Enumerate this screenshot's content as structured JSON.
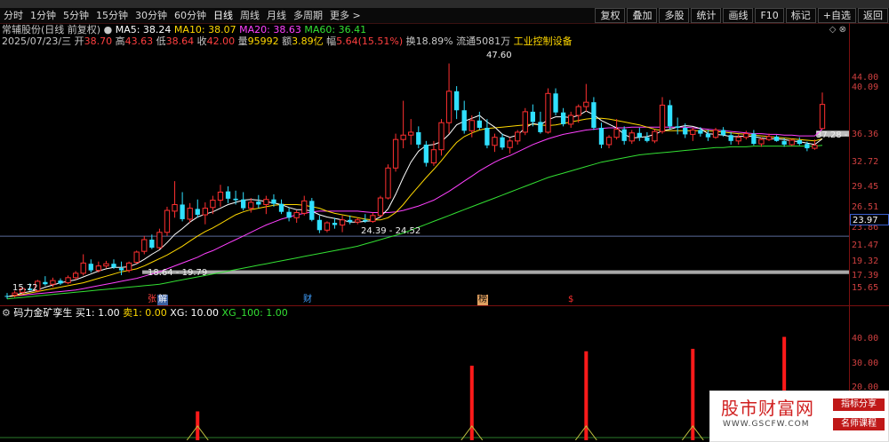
{
  "toolbar": {
    "left": [
      "分时",
      "1分钟",
      "5分钟",
      "15分钟",
      "30分钟",
      "60分钟",
      "日线",
      "周线",
      "月线",
      "多周期",
      "更多 >"
    ],
    "right": [
      "复权",
      "叠加",
      "多股",
      "统计",
      "画线",
      "F10",
      "标记",
      "+自选",
      "返回"
    ]
  },
  "header": {
    "name": "常辅股份(日线 前复权)",
    "ma5": "MA5: 38.24",
    "ma10": "MA10: 38.07",
    "ma20": "MA20: 38.63",
    "ma60": "MA60: 36.41",
    "date": "2025/07/23/三",
    "open_label": "开",
    "open": "38.70",
    "high_label": "高",
    "high": "43.63",
    "low_label": "低",
    "low": "38.64",
    "close_label": "收",
    "close": "42.00",
    "vol_label": "量",
    "vol": "95992",
    "amt_label": "额",
    "amt": "3.89亿",
    "chg_label": "幅",
    "chg": "5.64(15.51%)",
    "turn": "换18.89%",
    "float": "流通5081万",
    "industry": "工业控制设备",
    "icons": "◇ ⊗"
  },
  "yaxis": [
    "44.00",
    "40.09",
    "36.36",
    "32.72",
    "29.45",
    "26.51",
    "23.97",
    "23.86",
    "21.47",
    "19.32",
    "17.39",
    "15.65"
  ],
  "current_price": "23.97",
  "annotations": {
    "peak": "47.60",
    "right": "37.28 -",
    "mid": "24.39 - 24.52",
    "left_low": "18.64 - 19.79",
    "start": "15.72"
  },
  "markers": {
    "m1": "张",
    "m2": "解",
    "m3": "财",
    "m4": "榜",
    "m5": "$"
  },
  "indicator": {
    "name": "码力金矿孪生",
    "buy": "买1: 1.00",
    "sell": "卖1: 0.00",
    "xg": "XG: 10.00",
    "xg100": "XG_100: 1.00",
    "yaxis": [
      "40.00",
      "30.00",
      "20.00"
    ]
  },
  "watermark": {
    "title": "股市财富网",
    "url": "WWW.GSCFW.COM",
    "tag1": "指标分享",
    "tag2": "名师课程"
  },
  "colors": {
    "up": "#ff3030",
    "down": "#30e0ff",
    "ma5": "#ffffff",
    "ma10": "#ffd800",
    "ma20": "#ff40ff",
    "ma60": "#33e033"
  },
  "chart_data": {
    "type": "candlestick",
    "ylim": [
      15.0,
      49.0
    ],
    "candles": [
      [
        15.8,
        16.2,
        15.4,
        15.72
      ],
      [
        15.9,
        16.5,
        15.6,
        16.2
      ],
      [
        16.3,
        17.0,
        16.0,
        16.8
      ],
      [
        16.8,
        17.5,
        16.5,
        16.6
      ],
      [
        16.5,
        18.0,
        16.3,
        17.8
      ],
      [
        17.7,
        18.5,
        17.2,
        17.4
      ],
      [
        17.4,
        18.3,
        17.0,
        17.9
      ],
      [
        17.9,
        18.2,
        17.3,
        17.5
      ],
      [
        17.6,
        18.6,
        17.4,
        18.3
      ],
      [
        18.3,
        19.2,
        18.0,
        18.9
      ],
      [
        18.9,
        21.5,
        18.6,
        20.3
      ],
      [
        20.2,
        20.8,
        19.0,
        19.3
      ],
      [
        19.3,
        20.5,
        19.0,
        19.9
      ],
      [
        19.9,
        20.6,
        19.6,
        20.2
      ],
      [
        20.2,
        20.8,
        19.5,
        19.7
      ],
      [
        19.6,
        20.5,
        18.64,
        19.3
      ],
      [
        19.3,
        20.5,
        19.0,
        20.3
      ],
      [
        20.4,
        22.0,
        20.2,
        21.8
      ],
      [
        21.9,
        24.0,
        21.5,
        23.5
      ],
      [
        23.5,
        24.2,
        22.2,
        22.4
      ],
      [
        22.4,
        25.0,
        22.2,
        24.5
      ],
      [
        24.5,
        28.0,
        24.0,
        27.5
      ],
      [
        27.4,
        31.5,
        26.5,
        28.3
      ],
      [
        28.3,
        30.0,
        26.0,
        26.3
      ],
      [
        26.3,
        28.5,
        25.8,
        27.8
      ],
      [
        27.7,
        29.0,
        26.5,
        26.9
      ],
      [
        26.9,
        28.6,
        25.6,
        27.8
      ],
      [
        27.9,
        29.5,
        27.0,
        28.9
      ],
      [
        28.9,
        31.0,
        28.0,
        30.0
      ],
      [
        30.1,
        30.8,
        28.5,
        29.1
      ],
      [
        29.1,
        30.2,
        28.3,
        28.9
      ],
      [
        29.0,
        30.0,
        27.5,
        27.8
      ],
      [
        27.8,
        29.2,
        27.2,
        28.6
      ],
      [
        28.7,
        29.6,
        27.8,
        28.3
      ],
      [
        28.3,
        29.5,
        27.0,
        29.0
      ],
      [
        29.0,
        29.7,
        28.0,
        28.4
      ],
      [
        28.4,
        29.0,
        27.0,
        27.3
      ],
      [
        27.3,
        27.9,
        26.0,
        26.5
      ],
      [
        26.5,
        27.5,
        25.8,
        27.2
      ],
      [
        27.1,
        29.5,
        26.8,
        28.8
      ],
      [
        28.8,
        29.2,
        26.0,
        26.2
      ],
      [
        26.2,
        26.8,
        24.39,
        24.8
      ],
      [
        24.8,
        26.0,
        24.5,
        25.8
      ],
      [
        25.8,
        26.5,
        25.0,
        25.5
      ],
      [
        25.5,
        26.8,
        24.52,
        26.2
      ],
      [
        26.2,
        26.8,
        25.6,
        25.9
      ],
      [
        25.9,
        26.5,
        25.6,
        26.2
      ],
      [
        26.2,
        27.0,
        25.8,
        26.0
      ],
      [
        26.0,
        27.2,
        25.8,
        26.8
      ],
      [
        26.8,
        29.5,
        26.6,
        29.2
      ],
      [
        29.2,
        33.8,
        29.0,
        33.3
      ],
      [
        33.3,
        38.0,
        32.8,
        37.2
      ],
      [
        37.2,
        42.5,
        36.0,
        37.8
      ],
      [
        37.8,
        40.0,
        36.5,
        38.2
      ],
      [
        38.2,
        39.0,
        36.0,
        36.5
      ],
      [
        36.5,
        37.0,
        33.5,
        34.0
      ],
      [
        34.0,
        37.0,
        33.6,
        35.8
      ],
      [
        35.8,
        40.0,
        35.0,
        39.5
      ],
      [
        39.5,
        47.6,
        38.0,
        43.8
      ],
      [
        43.8,
        44.5,
        40.0,
        41.2
      ],
      [
        41.2,
        42.5,
        38.0,
        38.4
      ],
      [
        38.4,
        40.5,
        37.5,
        39.8
      ],
      [
        39.8,
        41.0,
        38.5,
        38.8
      ],
      [
        38.8,
        40.0,
        36.0,
        36.4
      ],
      [
        36.4,
        38.0,
        35.5,
        37.5
      ],
      [
        37.5,
        38.0,
        35.8,
        36.1
      ],
      [
        36.1,
        37.5,
        35.3,
        37.0
      ],
      [
        37.0,
        38.5,
        36.5,
        38.2
      ],
      [
        38.2,
        41.5,
        37.8,
        41.0
      ],
      [
        41.0,
        42.0,
        39.0,
        39.6
      ],
      [
        39.6,
        41.0,
        38.0,
        38.2
      ],
      [
        38.2,
        44.2,
        38.0,
        43.5
      ],
      [
        43.5,
        44.2,
        40.5,
        40.9
      ],
      [
        40.9,
        41.5,
        39.0,
        39.3
      ],
      [
        39.3,
        41.0,
        38.8,
        40.5
      ],
      [
        40.5,
        42.0,
        39.5,
        41.7
      ],
      [
        41.7,
        44.8,
        41.0,
        42.3
      ],
      [
        42.3,
        43.0,
        38.5,
        38.8
      ],
      [
        38.8,
        39.5,
        36.0,
        36.5
      ],
      [
        36.5,
        37.8,
        36.0,
        37.5
      ],
      [
        37.5,
        40.0,
        37.2,
        38.6
      ],
      [
        38.6,
        39.0,
        36.5,
        37.0
      ],
      [
        37.0,
        38.5,
        36.6,
        38.1
      ],
      [
        38.1,
        38.8,
        37.0,
        37.5
      ],
      [
        37.5,
        38.2,
        36.8,
        37.0
      ],
      [
        37.0,
        38.6,
        36.7,
        38.3
      ],
      [
        38.3,
        43.0,
        38.0,
        41.9
      ],
      [
        41.9,
        42.6,
        38.6,
        39.0
      ],
      [
        39.0,
        40.2,
        37.9,
        38.8
      ],
      [
        38.8,
        39.4,
        37.4,
        37.9
      ],
      [
        37.9,
        38.8,
        37.0,
        38.5
      ],
      [
        38.5,
        38.9,
        37.6,
        38.0
      ],
      [
        38.0,
        38.5,
        37.0,
        37.5
      ],
      [
        37.5,
        38.8,
        37.3,
        38.5
      ],
      [
        38.5,
        38.9,
        37.6,
        37.8
      ],
      [
        37.8,
        38.2,
        36.5,
        37.0
      ],
      [
        37.0,
        37.9,
        36.5,
        37.5
      ],
      [
        37.5,
        38.4,
        37.2,
        38.0
      ],
      [
        38.0,
        38.5,
        36.4,
        36.6
      ],
      [
        36.6,
        37.5,
        36.2,
        37.2
      ],
      [
        37.2,
        38.0,
        37.0,
        37.6
      ],
      [
        37.6,
        37.8,
        36.9,
        37.0
      ],
      [
        37.0,
        37.4,
        36.2,
        36.5
      ],
      [
        36.5,
        37.3,
        36.3,
        37.1
      ],
      [
        37.1,
        37.5,
        36.4,
        36.6
      ],
      [
        36.6,
        36.9,
        35.6,
        36.0
      ],
      [
        36.0,
        37.2,
        35.8,
        36.4
      ],
      [
        38.7,
        43.63,
        38.64,
        42.0
      ]
    ],
    "ma5": [
      15.7,
      15.9,
      16.2,
      16.4,
      16.6,
      17.0,
      17.3,
      17.6,
      17.8,
      18.0,
      18.4,
      18.8,
      19.2,
      19.5,
      19.7,
      19.7,
      19.8,
      20.2,
      20.8,
      21.5,
      22.1,
      23.1,
      24.2,
      25.0,
      25.9,
      26.6,
      27.0,
      27.3,
      27.8,
      28.3,
      28.6,
      28.9,
      29.0,
      28.9,
      28.7,
      28.5,
      28.3,
      27.9,
      27.6,
      27.6,
      27.4,
      26.9,
      26.6,
      26.4,
      26.2,
      25.9,
      25.9,
      26.0,
      26.1,
      26.6,
      27.7,
      29.7,
      32.0,
      34.1,
      35.6,
      36.4,
      36.5,
      36.9,
      37.9,
      39.2,
      39.7,
      40.1,
      40.5,
      39.6,
      38.9,
      37.9,
      37.5,
      37.8,
      38.8,
      39.4,
      39.2,
      39.9,
      40.3,
      40.3,
      40.2,
      40.5,
      41.1,
      40.6,
      39.8,
      39.3,
      38.8,
      37.9,
      37.4,
      37.5,
      37.6,
      37.9,
      38.4,
      38.6,
      38.9,
      39.1,
      39.0,
      38.7,
      38.0,
      37.9,
      37.8,
      37.6,
      37.6,
      37.7,
      37.6,
      37.4,
      37.3,
      37.3,
      37.2,
      37.0,
      36.9,
      36.7,
      36.5,
      37.3
    ],
    "ma10": [
      15.7,
      15.8,
      16.0,
      16.2,
      16.4,
      16.6,
      16.8,
      17.0,
      17.2,
      17.4,
      17.6,
      17.9,
      18.2,
      18.5,
      18.8,
      19.1,
      19.3,
      19.5,
      19.9,
      20.4,
      20.9,
      21.4,
      22.0,
      22.6,
      23.3,
      24.0,
      24.6,
      25.1,
      25.7,
      26.3,
      26.9,
      27.3,
      27.6,
      27.8,
      28.0,
      28.2,
      28.3,
      28.3,
      28.3,
      28.2,
      28.0,
      27.8,
      27.4,
      27.1,
      26.9,
      26.7,
      26.5,
      26.3,
      26.2,
      26.2,
      26.5,
      27.2,
      28.3,
      29.6,
      30.8,
      32.0,
      33.1,
      34.3,
      35.6,
      36.8,
      37.6,
      38.1,
      38.5,
      38.7,
      38.8,
      38.9,
      39.0,
      39.1,
      39.2,
      39.3,
      39.2,
      39.1,
      39.2,
      39.4,
      39.6,
      39.8,
      40.0,
      40.1,
      40.1,
      40.0,
      39.8,
      39.6,
      39.4,
      39.2,
      38.9,
      38.6,
      38.4,
      38.4,
      38.4,
      38.4,
      38.4,
      38.4,
      38.4,
      38.3,
      38.2,
      38.1,
      38.0,
      37.9,
      37.8,
      37.7,
      37.6,
      37.5,
      37.4,
      37.3,
      37.2,
      37.1,
      37.0,
      37.3
    ],
    "ma20": [
      15.7,
      15.8,
      15.9,
      16.0,
      16.1,
      16.2,
      16.3,
      16.4,
      16.5,
      16.6,
      16.8,
      17.0,
      17.2,
      17.4,
      17.6,
      17.8,
      18.0,
      18.2,
      18.5,
      18.8,
      19.1,
      19.5,
      19.9,
      20.3,
      20.7,
      21.1,
      21.6,
      22.0,
      22.5,
      23.0,
      23.5,
      24.0,
      24.5,
      25.0,
      25.5,
      25.9,
      26.3,
      26.6,
      26.9,
      27.1,
      27.3,
      27.4,
      27.4,
      27.4,
      27.4,
      27.4,
      27.4,
      27.3,
      27.2,
      27.2,
      27.2,
      27.3,
      27.5,
      27.8,
      28.1,
      28.5,
      28.9,
      29.5,
      30.1,
      30.8,
      31.5,
      32.2,
      32.9,
      33.5,
      34.1,
      34.6,
      35.0,
      35.5,
      36.0,
      36.5,
      36.9,
      37.3,
      37.6,
      37.9,
      38.1,
      38.3,
      38.5,
      38.6,
      38.7,
      38.8,
      38.8,
      38.8,
      38.9,
      38.9,
      38.9,
      38.9,
      38.9,
      38.9,
      38.9,
      38.9,
      38.8,
      38.7,
      38.6,
      38.5,
      38.4,
      38.3,
      38.2,
      38.1,
      38.0,
      38.0,
      37.9,
      37.9,
      37.8,
      37.8,
      37.7,
      37.7,
      37.7,
      38.63
    ],
    "ma60": [
      15.4,
      15.5,
      15.6,
      15.7,
      15.8,
      15.9,
      16.0,
      16.1,
      16.2,
      16.3,
      16.4,
      16.5,
      16.6,
      16.7,
      16.8,
      16.9,
      17.0,
      17.1,
      17.2,
      17.3,
      17.4,
      17.6,
      17.8,
      18.0,
      18.2,
      18.4,
      18.6,
      18.8,
      19.0,
      19.2,
      19.4,
      19.6,
      19.8,
      20.0,
      20.2,
      20.4,
      20.6,
      20.8,
      21.0,
      21.2,
      21.4,
      21.6,
      21.8,
      22.0,
      22.2,
      22.4,
      22.6,
      22.9,
      23.2,
      23.5,
      23.8,
      24.1,
      24.4,
      24.8,
      25.2,
      25.6,
      26.0,
      26.4,
      26.8,
      27.2,
      27.6,
      28.0,
      28.4,
      28.8,
      29.2,
      29.6,
      30.0,
      30.4,
      30.8,
      31.2,
      31.6,
      32.0,
      32.3,
      32.6,
      32.9,
      33.2,
      33.5,
      33.8,
      34.1,
      34.3,
      34.5,
      34.7,
      34.9,
      35.1,
      35.2,
      35.3,
      35.4,
      35.5,
      35.6,
      35.7,
      35.8,
      35.9,
      36.0,
      36.1,
      36.1,
      36.2,
      36.2,
      36.2,
      36.3,
      36.3,
      36.3,
      36.3,
      36.3,
      36.3,
      36.3,
      36.3,
      36.3,
      36.41
    ],
    "support_zones": [
      [
        18.8,
        19.3
      ],
      [
        37.6,
        38.4
      ]
    ],
    "level_line": 23.97,
    "indicator_bars": [
      {
        "index": 25,
        "value": 12
      },
      {
        "index": 61,
        "value": 31
      },
      {
        "index": 76,
        "value": 37
      },
      {
        "index": 90,
        "value": 38
      },
      {
        "index": 102,
        "value": 43
      }
    ],
    "indicator_ylim": [
      0,
      48
    ]
  }
}
